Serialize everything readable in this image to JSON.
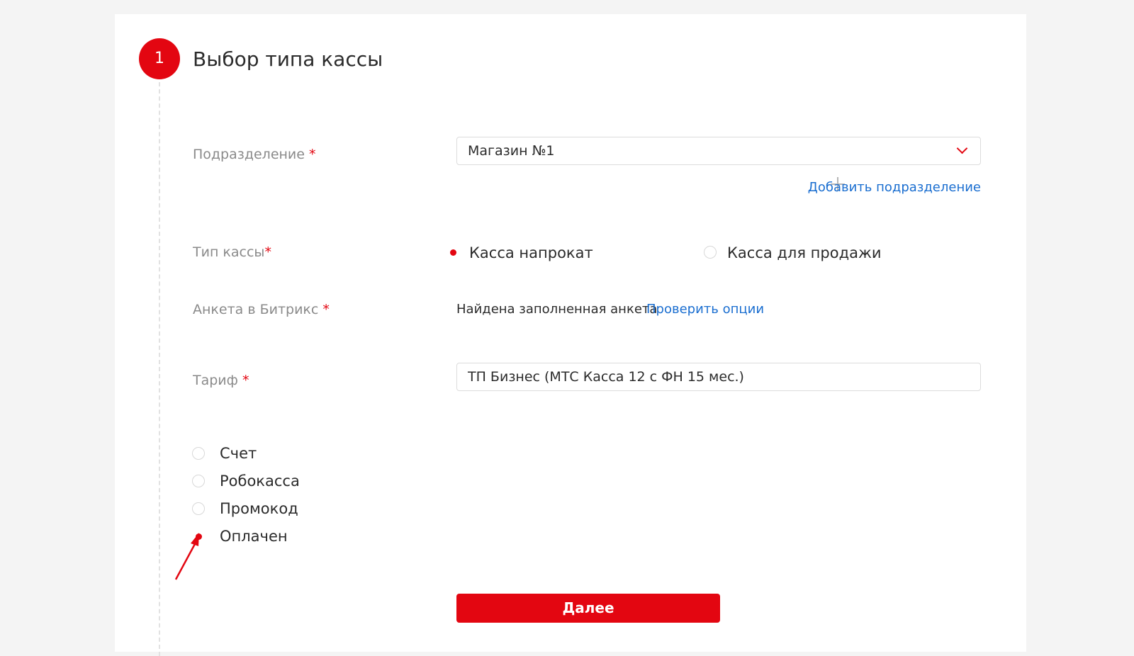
{
  "step": {
    "number": "1",
    "title": "Выбор типа кассы"
  },
  "subdivision": {
    "label": "Подразделение",
    "required": "*",
    "value": "Магазин №1",
    "add_link": "Добавить подразделение"
  },
  "cash_type": {
    "label": "Тип кассы",
    "required": "*",
    "options": [
      {
        "label": "Касса напрокат",
        "checked": true
      },
      {
        "label": "Касса для продажи",
        "checked": false
      }
    ]
  },
  "bitrix": {
    "label": "Анкета в Битрикс",
    "required": "*",
    "status": "Найдена заполненная анкета",
    "check_link": "Проверить опции"
  },
  "tariff": {
    "label": "Тариф",
    "required": "*",
    "value": "ТП Бизнес (МТС Касса 12 с ФН 15 мес.)"
  },
  "payment": {
    "options": [
      {
        "label": "Счет",
        "checked": false
      },
      {
        "label": "Робокасса",
        "checked": false
      },
      {
        "label": "Промокод",
        "checked": false
      },
      {
        "label": "Оплачен",
        "checked": true
      }
    ]
  },
  "next_button": "Далее",
  "colors": {
    "accent": "#e30611",
    "link": "#1a6ed0"
  },
  "annotation": {
    "arrow_color": "#e30611",
    "icon": "arrow-annotation"
  }
}
